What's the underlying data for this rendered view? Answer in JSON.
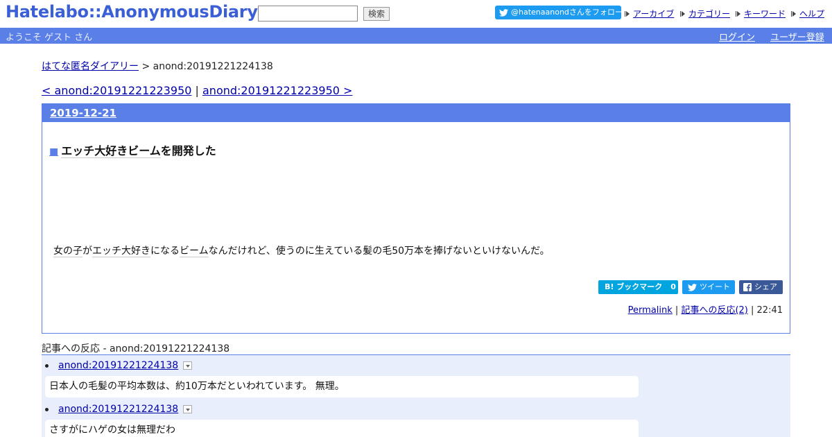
{
  "header": {
    "logo": "Hatelabo::AnonymousDiary",
    "search_placeholder": "",
    "search_button": "検索",
    "follow_label": "@hatenaanondさんをフォロー",
    "nav": [
      "アーカイブ",
      "カテゴリー",
      "キーワード",
      "ヘルプ"
    ]
  },
  "bar": {
    "welcome": "ようこそ ゲスト さん",
    "login": "ログイン",
    "signup": "ユーザー登録"
  },
  "breadcrumb": {
    "home": "はてな匿名ダイアリー",
    "separator": " > ",
    "current": "anond:20191221224138"
  },
  "pager": {
    "prev": "< anond:20191221223950",
    "sep": " | ",
    "next": "anond:20191221223950 >"
  },
  "day": {
    "date": "2019-12-21",
    "title_marker": "■",
    "title_parts": [
      "エッチ大好き",
      "ビーム",
      "を開発した"
    ],
    "body_parts": [
      "女の子",
      "が",
      "エッチ大好き",
      "になる",
      "ビーム",
      "なんだけれど、使うのに生えている髪の毛50万本を捧げないといけないんだ。"
    ],
    "hatebu_label": "B! ブックマーク",
    "hatebu_count": "0",
    "tweet_label": "ツイート",
    "share_label": "シェア",
    "permalink": "Permalink",
    "meta_sep1": " | ",
    "reactions_link": "記事への反応(2)",
    "meta_sep2": " | ",
    "time": "22:41"
  },
  "reactions": {
    "title_prefix": "記事への反応",
    "title_suffix": " - anond:20191221224138",
    "items": [
      {
        "id": "anond:20191221224138",
        "text": "日本人の毛髪の平均本数は、約10万本だといわれています。 無理。"
      },
      {
        "id": "anond:20191221224138",
        "text": "さすがにハゲの女は無理だわ"
      }
    ]
  },
  "colors": {
    "brand_blue": "#5a7fe6",
    "twitter": "#1d9bf0",
    "hatebu": "#00a4de",
    "facebook": "#3b5998",
    "reaction_bg": "#e8eefc"
  }
}
